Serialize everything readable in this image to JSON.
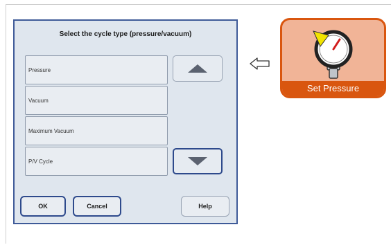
{
  "dialog": {
    "title": "Select the cycle type (pressure/vacuum)",
    "options": [
      "Pressure",
      "Vacuum",
      "Maximum Vacuum",
      "P/V Cycle"
    ],
    "buttons": {
      "ok": "OK",
      "cancel": "Cancel",
      "help": "Help"
    }
  },
  "tile": {
    "label": "Set Pressure",
    "icon": "pressure-gauge-icon"
  },
  "icons": {
    "up": "triangle-up-icon",
    "down": "triangle-down-icon",
    "pointer": "left-arrow-icon"
  },
  "colors": {
    "dialog_border": "#3e5a98",
    "tile_fill": "#f1b497",
    "tile_accent": "#d9560f"
  }
}
